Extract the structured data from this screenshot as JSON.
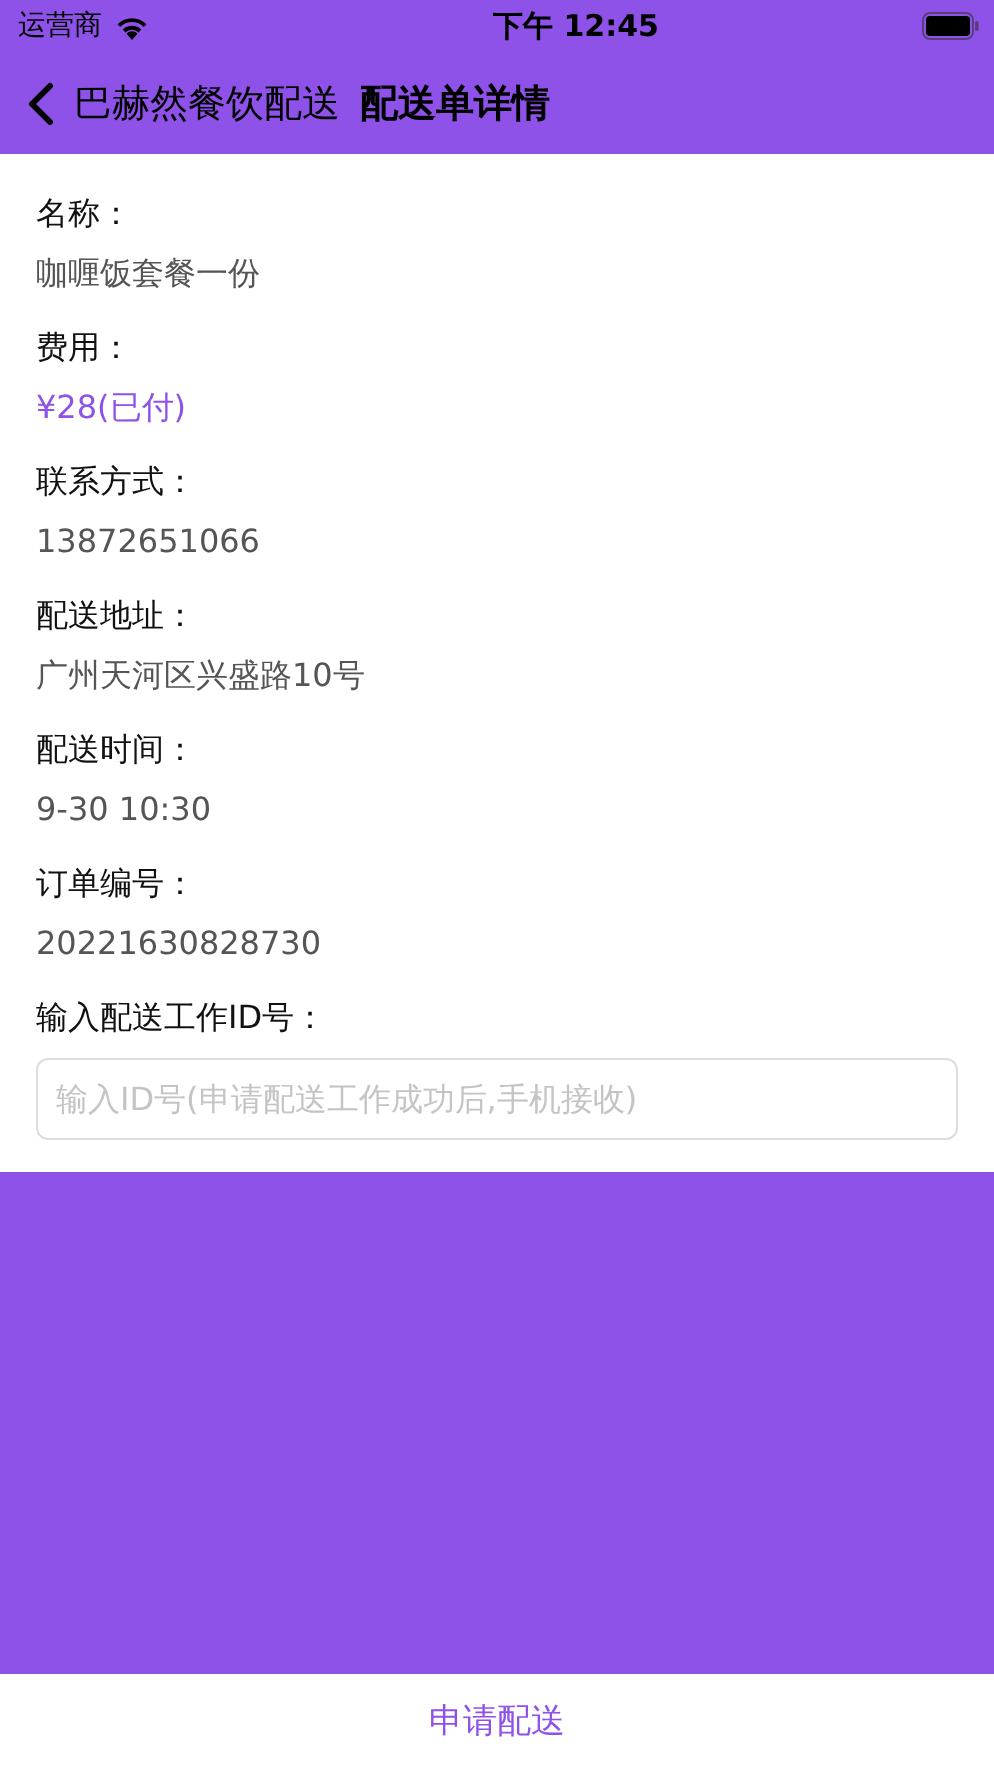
{
  "status_bar": {
    "carrier": "运营商",
    "time": "下午 12:45"
  },
  "nav": {
    "back_label": "巴赫然餐饮配送",
    "title": "配送单详情"
  },
  "fields": [
    {
      "label": "名称：",
      "value": "咖喱饭套餐一份",
      "kind": "text"
    },
    {
      "label": "费用：",
      "value": "¥28(已付)",
      "kind": "price"
    },
    {
      "label": "联系方式：",
      "value": "13872651066",
      "kind": "text"
    },
    {
      "label": "配送地址：",
      "value": "广州天河区兴盛路10号",
      "kind": "text"
    },
    {
      "label": "配送时间：",
      "value": "9-30 10:30",
      "kind": "text"
    },
    {
      "label": "订单编号：",
      "value": "20221630828730",
      "kind": "text"
    }
  ],
  "id_input": {
    "label": "输入配送工作ID号：",
    "placeholder": "输入ID号(申请配送工作成功后,手机接收)"
  },
  "submit_button": "申请配送"
}
